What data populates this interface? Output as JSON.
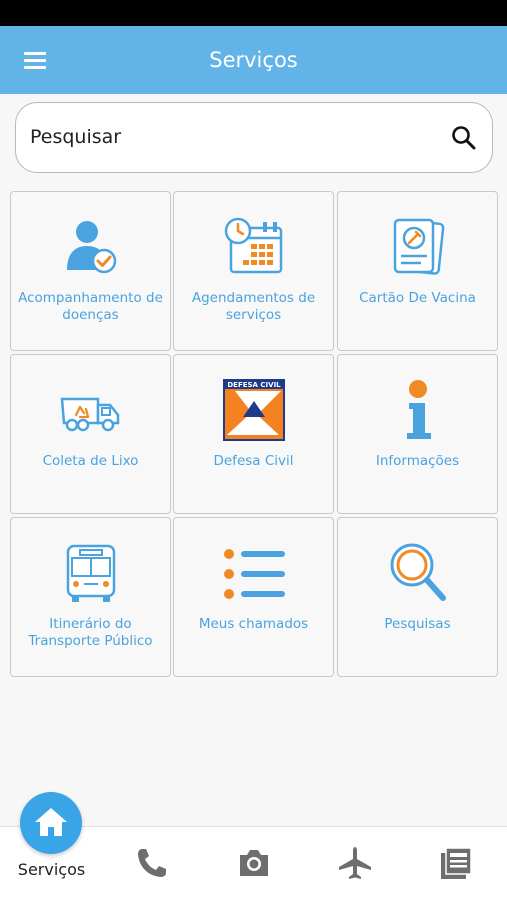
{
  "app_bar": {
    "title": "Serviços",
    "menu_icon": "hamburger-menu-icon"
  },
  "search": {
    "placeholder": "Pesquisar",
    "value": "",
    "icon": "search-icon"
  },
  "tiles": [
    {
      "label": "Acompanhamento de doenças",
      "icon": "person-check-icon"
    },
    {
      "label": "Agendamentos de serviços",
      "icon": "calendar-clock-icon"
    },
    {
      "label": "Cartão De Vacina",
      "icon": "vaccine-card-icon"
    },
    {
      "label": "Coleta de Lixo",
      "icon": "garbage-truck-icon"
    },
    {
      "label": "Defesa Civil",
      "icon": "defesa-civil-logo"
    },
    {
      "label": "Informações",
      "icon": "info-icon"
    },
    {
      "label": "Itinerário do Transporte Público",
      "icon": "bus-icon"
    },
    {
      "label": "Meus chamados",
      "icon": "list-icon"
    },
    {
      "label": "Pesquisas",
      "icon": "magnifier-icon"
    }
  ],
  "defesa_civil_logo_text": "DEFESA CIVIL",
  "bottom_nav": {
    "active_label": "Serviços",
    "items": [
      "home-icon",
      "phone-icon",
      "camera-icon",
      "airplane-icon",
      "news-icon"
    ]
  },
  "colors": {
    "primary": "#62b4e8",
    "accent_orange": "#f08a24",
    "label_blue": "#4aa3df"
  }
}
